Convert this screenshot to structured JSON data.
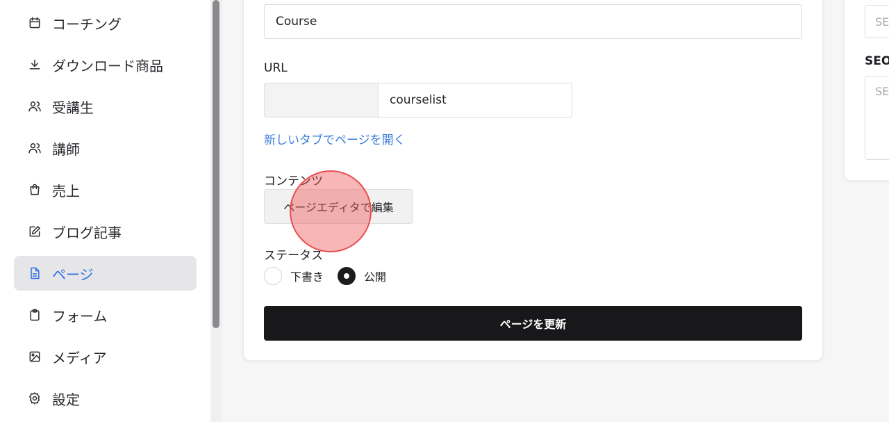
{
  "sidebar": {
    "items": [
      {
        "label": "コーチング",
        "icon": "calendar-icon",
        "active": false
      },
      {
        "label": "ダウンロード商品",
        "icon": "download-icon",
        "active": false
      },
      {
        "label": "受講生",
        "icon": "users-icon",
        "active": false
      },
      {
        "label": "講師",
        "icon": "users-icon",
        "active": false
      },
      {
        "label": "売上",
        "icon": "shopping-bag-icon",
        "active": false
      },
      {
        "label": "ブログ記事",
        "icon": "edit-icon",
        "active": false
      },
      {
        "label": "ページ",
        "icon": "file-text-icon",
        "active": true
      },
      {
        "label": "フォーム",
        "icon": "clipboard-icon",
        "active": false
      },
      {
        "label": "メディア",
        "icon": "image-icon",
        "active": false
      },
      {
        "label": "設定",
        "icon": "gear-icon",
        "active": false
      }
    ]
  },
  "form": {
    "title_value": "Course",
    "url_label": "URL",
    "url_slug_value": "courselist",
    "open_in_new_tab_link": "新しいタブでページを開く",
    "content_label": "コンテンツ",
    "edit_in_page_editor_button": "ページエディタで編集",
    "status_label": "ステータス",
    "status_options": [
      {
        "label": "下書き",
        "checked": false
      },
      {
        "label": "公開",
        "checked": true
      }
    ],
    "update_button": "ページを更新"
  },
  "right_panel": {
    "seo_input_placeholder": "SE",
    "seo_label": "SEO",
    "seo_textarea_placeholder": "SE"
  },
  "colors": {
    "accent": "#2f6fe4",
    "link": "#3b7ddd",
    "primary_button": "#18181b",
    "active_nav_bg": "#e6e6e8",
    "click_indicator": "#f05050"
  }
}
